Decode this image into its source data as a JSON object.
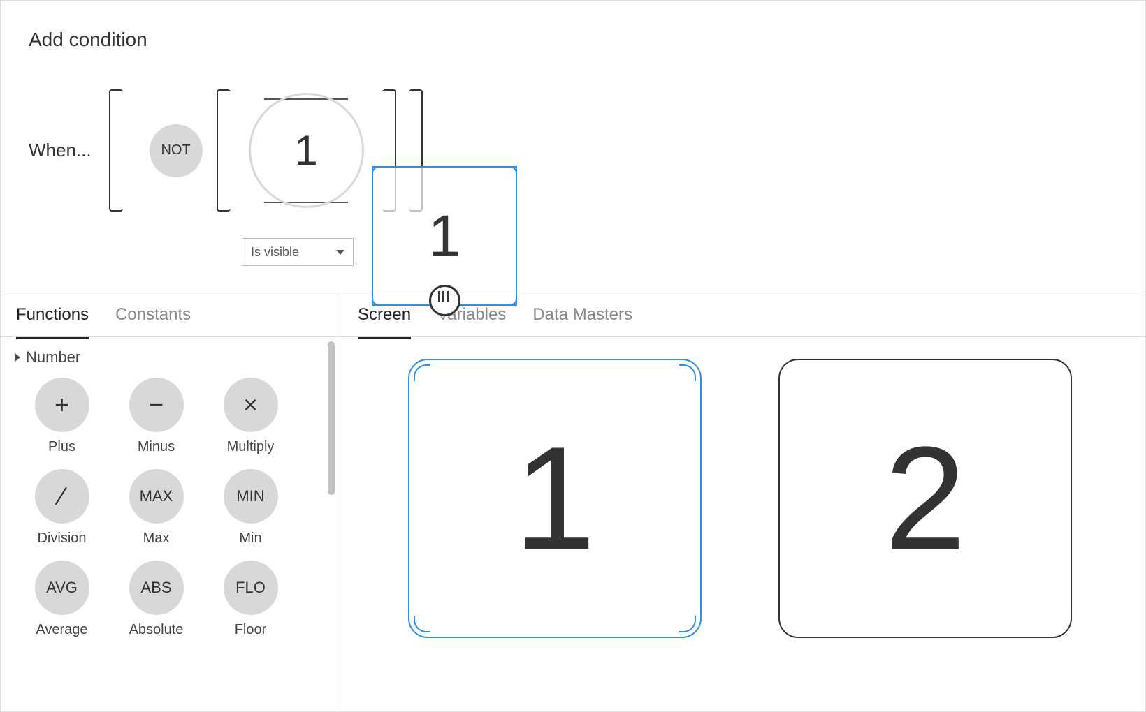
{
  "header": {
    "title": "Add condition"
  },
  "expression": {
    "when_label": "When...",
    "not_label": "NOT",
    "slot_value": "1",
    "visibility_select": {
      "value": "Is visible"
    },
    "drag_preview_value": "1"
  },
  "left_tabs": [
    {
      "label": "Functions",
      "active": true
    },
    {
      "label": "Constants",
      "active": false
    }
  ],
  "functions_section": {
    "header": "Number",
    "items": [
      {
        "symbol": "+",
        "label": "Plus",
        "is_symbol": true
      },
      {
        "symbol": "−",
        "label": "Minus",
        "is_symbol": true
      },
      {
        "symbol": "×",
        "label": "Multiply",
        "is_symbol": true
      },
      {
        "symbol": "∕",
        "label": "Division",
        "is_symbol": true
      },
      {
        "symbol": "MAX",
        "label": "Max",
        "is_symbol": false
      },
      {
        "symbol": "MIN",
        "label": "Min",
        "is_symbol": false
      },
      {
        "symbol": "AVG",
        "label": "Average",
        "is_symbol": false
      },
      {
        "symbol": "ABS",
        "label": "Absolute",
        "is_symbol": false
      },
      {
        "symbol": "FLO",
        "label": "Floor",
        "is_symbol": false
      }
    ]
  },
  "right_tabs": [
    {
      "label": "Screen",
      "active": true
    },
    {
      "label": "Variables",
      "active": false
    },
    {
      "label": "Data Masters",
      "active": false
    }
  ],
  "screen_items": [
    {
      "value": "1",
      "selected": true
    },
    {
      "value": "2",
      "selected": false
    }
  ]
}
